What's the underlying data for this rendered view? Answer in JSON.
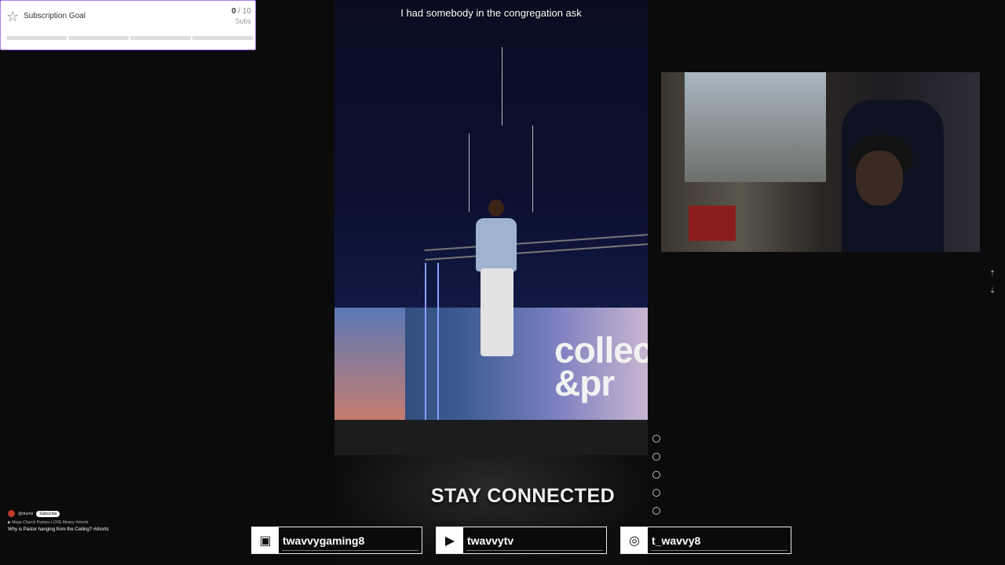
{
  "goal": {
    "title": "Subscription Goal",
    "current": "0",
    "sep": " / ",
    "target": "10",
    "unit": "Subs",
    "progress": 0.0,
    "accent": "#9b6cff"
  },
  "video": {
    "caption": "I had somebody in the congregation ask",
    "logo": "collec\n&pr"
  },
  "now_playing": {
    "channel": "@drumb",
    "subscribe": "Subscribe",
    "playlist": "▶ Mega Church Pastors LOVE Money #shorts",
    "title": "Why is Pastor hanging from the Ceiling? #shorts"
  },
  "overlay": {
    "heading": "STAY CONNECTED",
    "socials": [
      {
        "platform": "twitch",
        "icon": "twitch-icon",
        "handle": "twavvygaming8"
      },
      {
        "platform": "youtube",
        "icon": "youtube-icon",
        "handle": "twavvytv"
      },
      {
        "platform": "instagram",
        "icon": "instagram-icon",
        "handle": "t_wavvy8"
      }
    ]
  },
  "icons": {
    "goal": "star-icon",
    "scroll_up": "arrow-up-icon",
    "scroll_down": "arrow-down-icon"
  }
}
